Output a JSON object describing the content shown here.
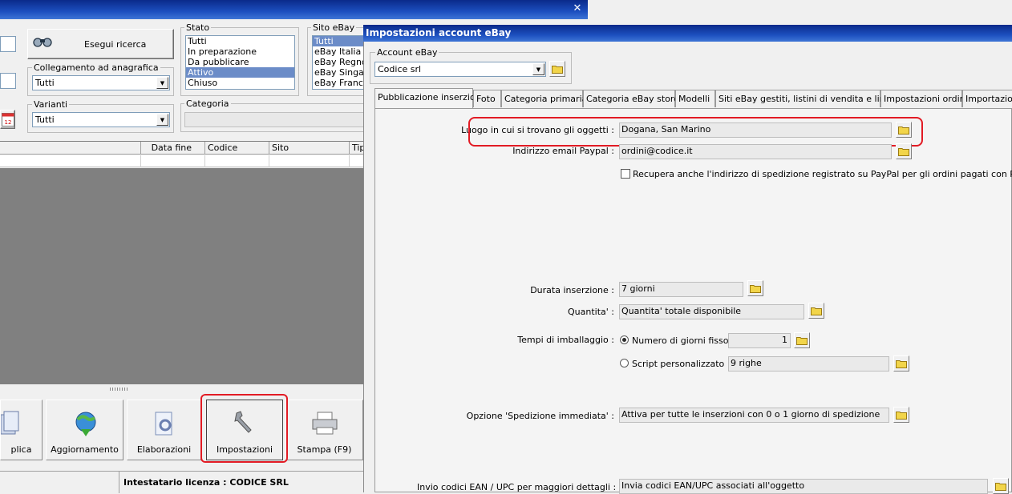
{
  "back_window": {
    "search_button": "Esegui ricerca",
    "stato": {
      "legend": "Stato",
      "items": [
        "Tutti",
        "In preparazione",
        "Da pubblicare",
        "Attivo",
        "Chiuso"
      ],
      "selected_index": 3
    },
    "sito": {
      "legend": "Sito eBay",
      "items": [
        "Tutti",
        "eBay Italia",
        "eBay Regno",
        "eBay Singap",
        "eBay Francia"
      ],
      "selected_index": 0
    },
    "collegamento": {
      "legend": "Collegamento ad anagrafica",
      "value": "Tutti"
    },
    "varianti": {
      "legend": "Varianti",
      "value": "Tutti"
    },
    "categoria": {
      "legend": "Categoria"
    },
    "columns": [
      "Data fine",
      "Codice",
      "Sito",
      "Tip"
    ],
    "toolbar": {
      "duplica": "plica",
      "aggiornamento": "Aggiornamento",
      "elaborazioni": "Elaborazioni",
      "impostazioni": "Impostazioni",
      "stampa": "Stampa (F9)"
    },
    "status": "Intestatario licenza : CODICE SRL",
    "calendar_num": "12"
  },
  "dialog": {
    "title": "Impostazioni account eBay",
    "account_legend": "Account eBay",
    "account_value": "Codice srl",
    "tabs": [
      "Pubblicazione inserzioni",
      "Foto",
      "Categoria primaria",
      "Categoria eBay store",
      "Modelli",
      "Siti eBay gestiti, listini di vendita e lingue",
      "Impostazioni ordini",
      "Importazion"
    ],
    "fields": {
      "luogo": {
        "label": "Luogo in cui si trovano gli oggetti :",
        "value": "Dogana, San Marino"
      },
      "email": {
        "label": "Indirizzo email Paypal :",
        "value": "ordini@codice.it"
      },
      "recupera": "Recupera anche l'indirizzo di spedizione registrato su PayPal per gli ordini pagati con PayPal",
      "durata": {
        "label": "Durata inserzione :",
        "value": "7 giorni"
      },
      "quantita": {
        "label": "Quantita' :",
        "value": "Quantita' totale disponibile"
      },
      "tempi": {
        "label": "Tempi di imballaggio :",
        "radio1": "Numero di giorni fisso",
        "radio1_value": "1",
        "radio2": "Script personalizzato",
        "radio2_value": "9 righe"
      },
      "spedizione": {
        "label": "Opzione 'Spedizione immediata' :",
        "value": "Attiva per tutte le inserzioni con 0 o 1 giorno di spedizione"
      },
      "ean": {
        "label": "Invio codici EAN / UPC per maggiori dettagli :",
        "value": "Invia codici EAN/UPC associati all'oggetto"
      }
    }
  },
  "colors": {
    "highlight": "#e21b24",
    "titlebar": "#1c4fbf",
    "selection": "#6b8cc8"
  }
}
